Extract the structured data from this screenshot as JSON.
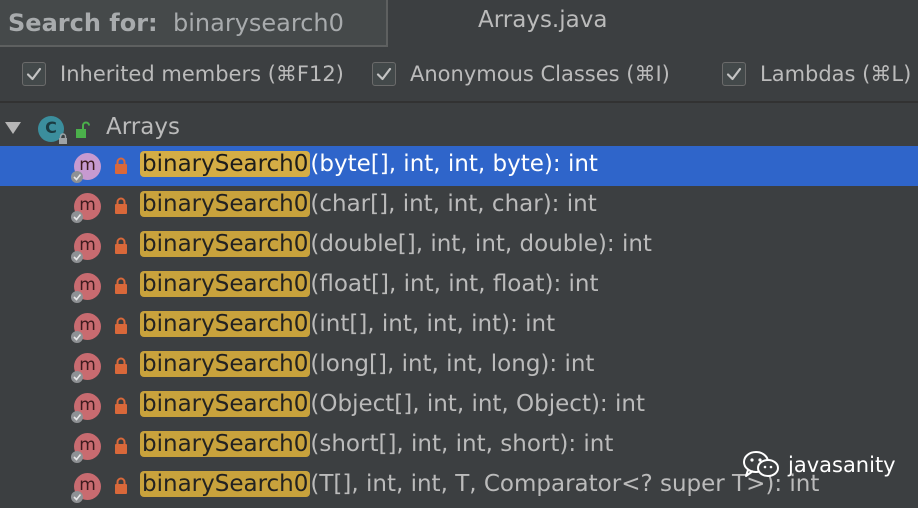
{
  "search": {
    "label": "Search for:",
    "value": "binarysearch0"
  },
  "file_title": "Arrays.java",
  "options": [
    {
      "label": "Inherited members (⌘F12)",
      "checked": true
    },
    {
      "label": "Anonymous Classes (⌘I)",
      "checked": true
    },
    {
      "label": "Lambdas (⌘L)",
      "checked": true
    }
  ],
  "tree": {
    "root": {
      "label": "Arrays",
      "icon_letter": "C"
    },
    "methods": [
      {
        "icon_letter": "m",
        "name": "binarySearch0",
        "params": "(byte[], int, int, byte): int"
      },
      {
        "icon_letter": "m",
        "name": "binarySearch0",
        "params": "(char[], int, int, char): int"
      },
      {
        "icon_letter": "m",
        "name": "binarySearch0",
        "params": "(double[], int, int, double): int"
      },
      {
        "icon_letter": "m",
        "name": "binarySearch0",
        "params": "(float[], int, int, float): int"
      },
      {
        "icon_letter": "m",
        "name": "binarySearch0",
        "params": "(int[], int, int, int): int"
      },
      {
        "icon_letter": "m",
        "name": "binarySearch0",
        "params": "(long[], int, int, long): int"
      },
      {
        "icon_letter": "m",
        "name": "binarySearch0",
        "params": "(Object[], int, int, Object): int"
      },
      {
        "icon_letter": "m",
        "name": "binarySearch0",
        "params": "(short[], int, int, short): int"
      },
      {
        "icon_letter": "m",
        "name": "binarySearch0",
        "params": "(T[], int, int, T, Comparator<? super T>): int"
      }
    ],
    "selected_index": 0
  },
  "watermark": {
    "text": "javasanity"
  },
  "colors": {
    "selection": "#2f65ca",
    "highlight": "#c8a23c",
    "method_icon": "#c86b70",
    "lock": "#d9683a"
  }
}
